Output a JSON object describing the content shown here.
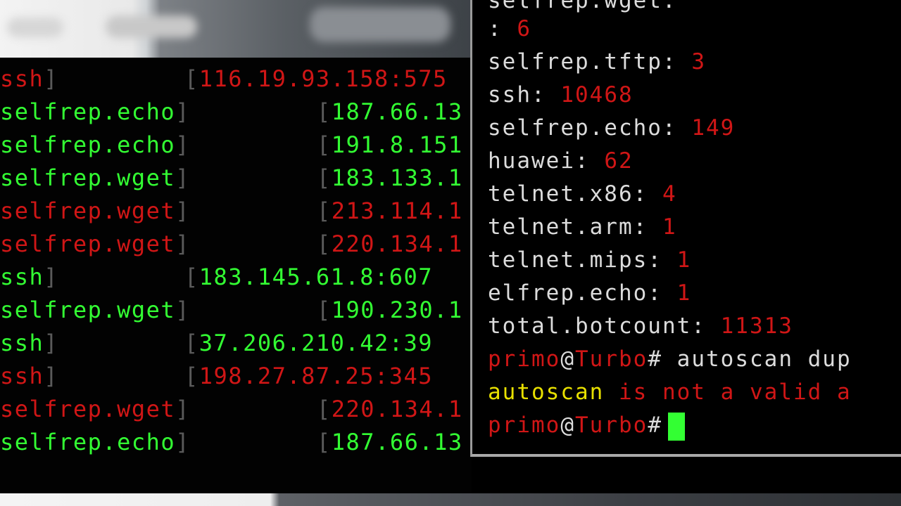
{
  "left_terminal": {
    "rows": [
      {
        "type": "ssh",
        "ip": "116.19.93.158:575",
        "color": "#d01616"
      },
      {
        "type": "selfrep.echo",
        "ip": "187.66.13",
        "color": "#33ff33"
      },
      {
        "type": "selfrep.echo",
        "ip": "191.8.151",
        "color": "#33ff33"
      },
      {
        "type": "selfrep.wget",
        "ip": "183.133.1",
        "color": "#33ff33"
      },
      {
        "type": "selfrep.wget",
        "ip": "213.114.1",
        "color": "#d01616"
      },
      {
        "type": "selfrep.wget",
        "ip": "220.134.1",
        "color": "#d01616"
      },
      {
        "type": "ssh",
        "ip": "183.145.61.8:607",
        "color": "#33ff33"
      },
      {
        "type": "selfrep.wget",
        "ip": "190.230.1",
        "color": "#33ff33"
      },
      {
        "type": "ssh",
        "ip": "37.206.210.42:39",
        "color": "#33ff33"
      },
      {
        "type": "ssh",
        "ip": "198.27.87.25:345",
        "color": "#d01616"
      },
      {
        "type": "selfrep.wget",
        "ip": "220.134.1",
        "color": "#d01616"
      },
      {
        "type": "selfrep.echo",
        "ip": "187.66.13",
        "color": "#33ff33"
      }
    ]
  },
  "right_terminal": {
    "top_partial": "selfrep.wget:",
    "stats": [
      {
        "label": ":",
        "value": "6"
      },
      {
        "label": "selfrep.tftp:",
        "value": "3"
      },
      {
        "label": "ssh:",
        "value": "10468"
      },
      {
        "label": "selfrep.echo:",
        "value": "149"
      },
      {
        "label": "huawei:",
        "value": "62"
      },
      {
        "label": "telnet.x86:",
        "value": "4"
      },
      {
        "label": "telnet.arm:",
        "value": "1"
      },
      {
        "label": "telnet.mips:",
        "value": "1"
      },
      {
        "label": "elfrep.echo:",
        "value": "1"
      },
      {
        "label": "total.botcount:",
        "value": "11313"
      }
    ],
    "prompt_user": "primo",
    "prompt_at": "@",
    "prompt_host": "Turbo",
    "prompt_symbol": "#",
    "command": "autoscan dup",
    "error_word": "autoscan",
    "error_rest": "is not a valid a",
    "colors": {
      "green": "#33ff33",
      "red": "#d01616",
      "yellow": "#e8e000",
      "text": "#dcdcdc"
    }
  }
}
